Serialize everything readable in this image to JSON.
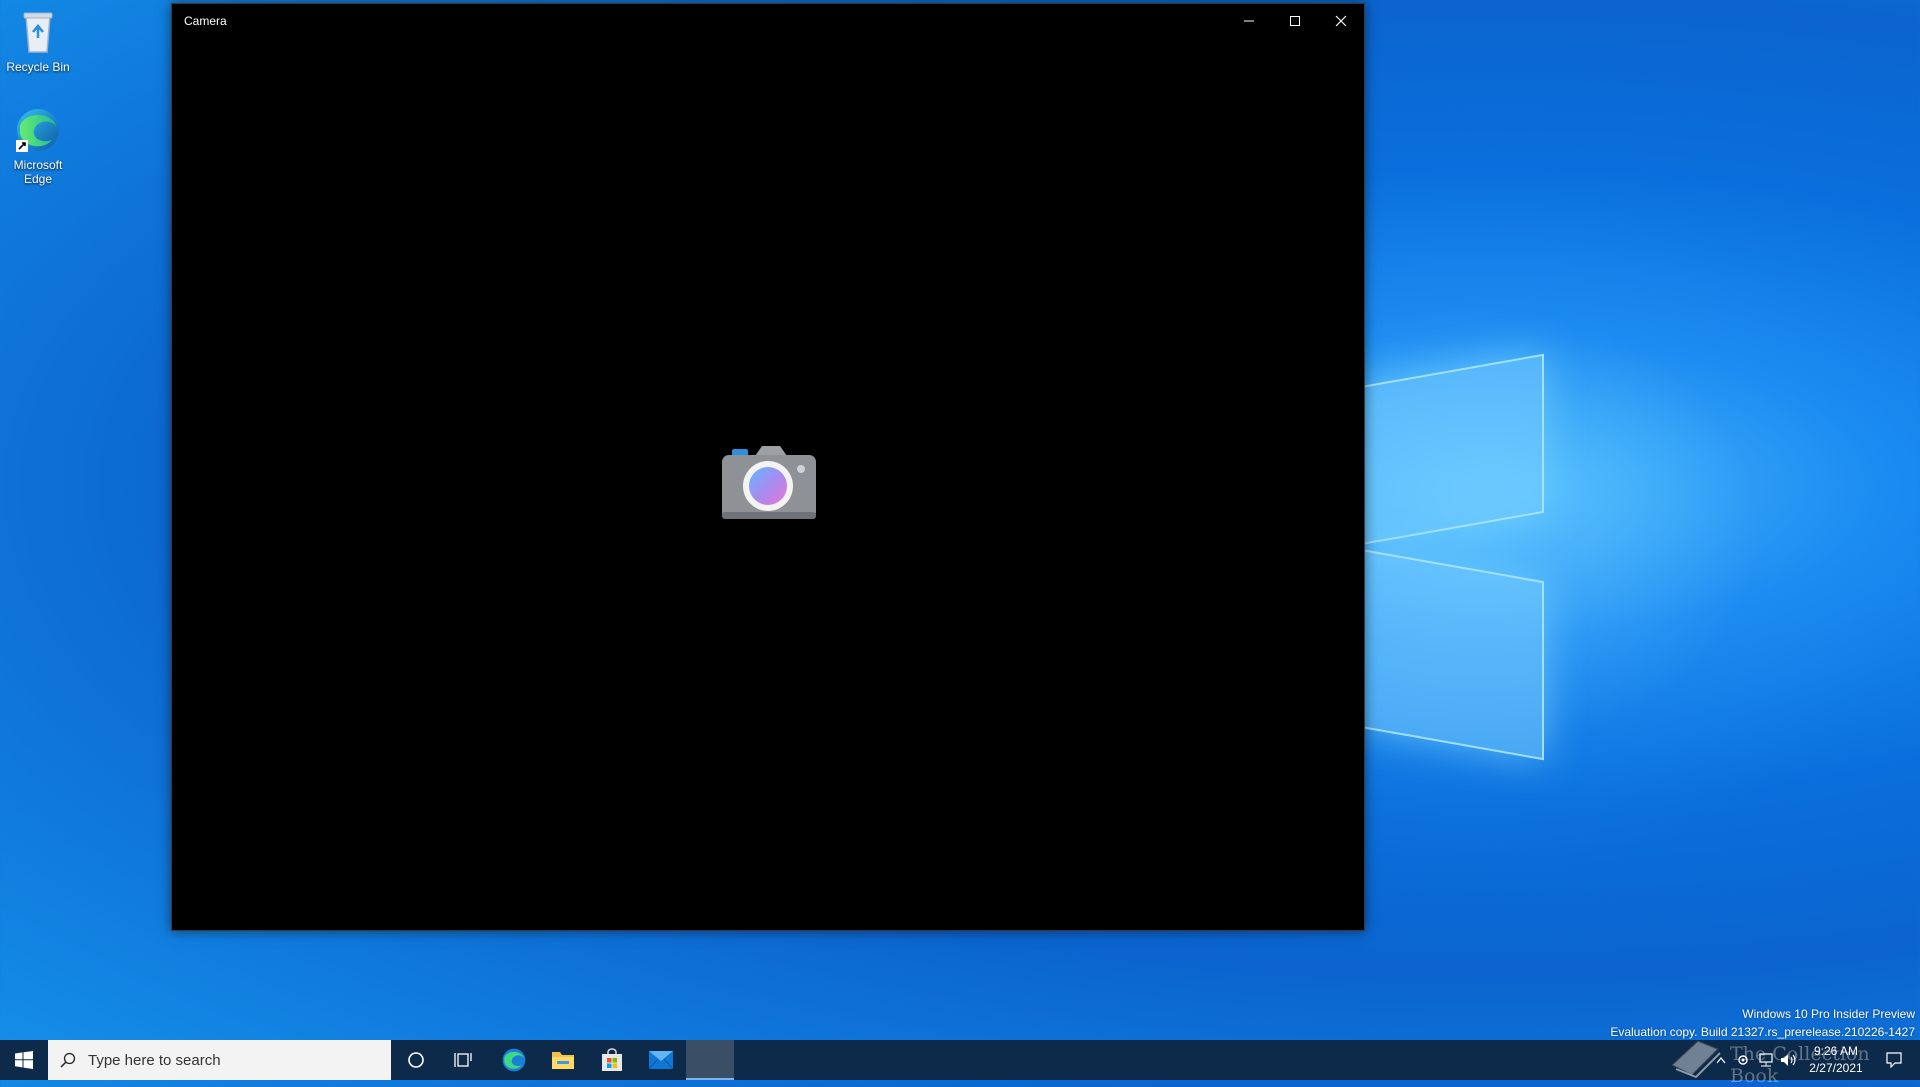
{
  "desktop": {
    "icons": [
      {
        "label": "Recycle Bin"
      },
      {
        "label": "Microsoft Edge"
      }
    ]
  },
  "window": {
    "title": "Camera"
  },
  "watermark": {
    "line1": "Windows 10 Pro Insider Preview",
    "line2": "Evaluation copy. Build 21327.rs_prerelease.210226-1427"
  },
  "taskbar": {
    "search_placeholder": "Type here to search",
    "clock_time": "9:26 AM",
    "clock_date": "2/27/2021",
    "overlay_text": "The Collection Book"
  },
  "colors": {
    "taskbar": "#0e2a4a",
    "desktop_accent": "#0a6fdc",
    "camera_body": "#8e9296",
    "camera_lens": "#a58cf0"
  }
}
